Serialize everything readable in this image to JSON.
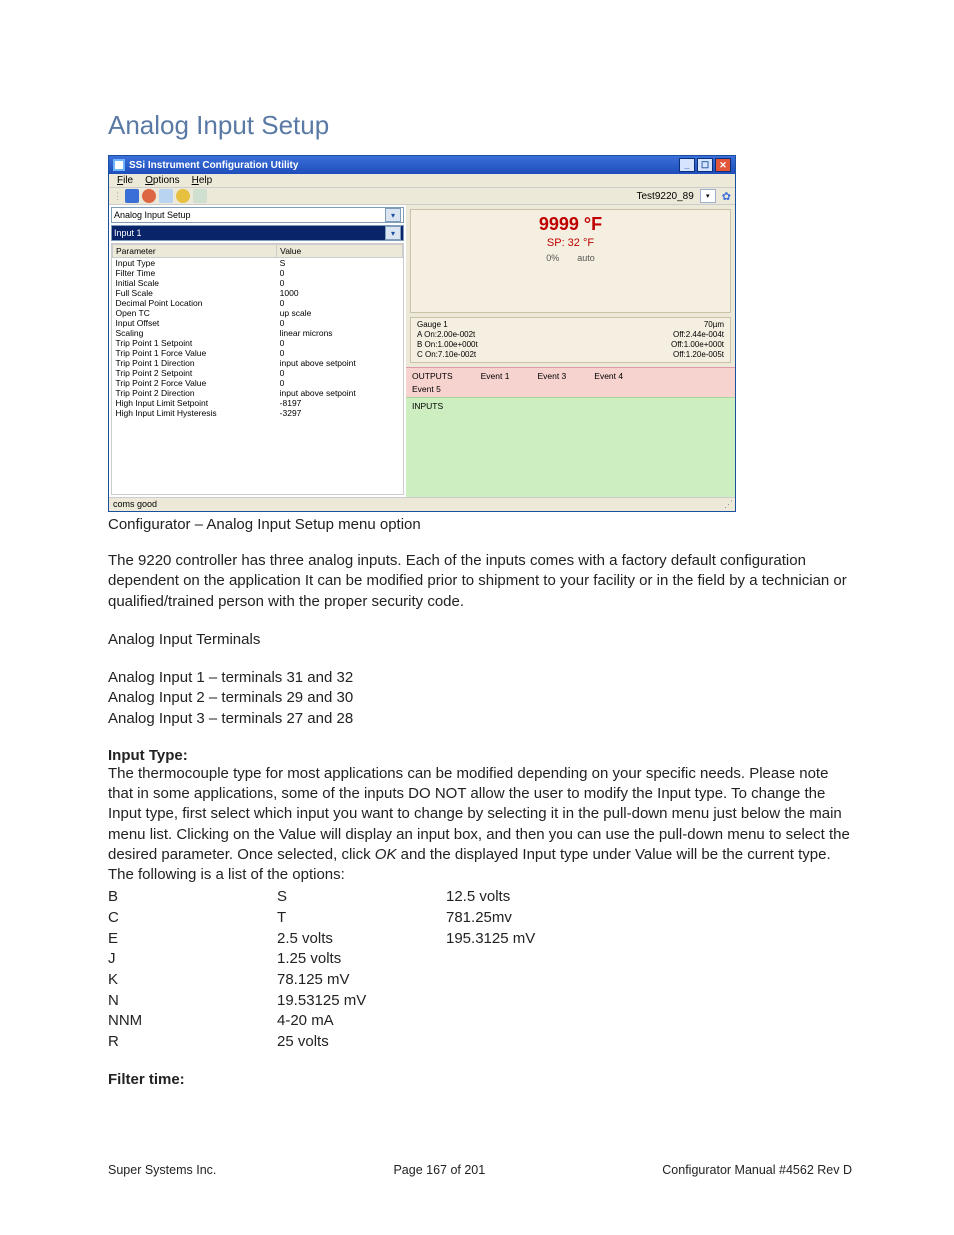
{
  "page_title": "Analog Input Setup",
  "screenshot": {
    "window_title": "SSi Instrument Configuration Utility",
    "menu": {
      "file": "File",
      "options": "Options",
      "help": "Help"
    },
    "toolbar_label": "Test9220_89",
    "dropdown_main": "Analog Input Setup",
    "dropdown_sub": "Input 1",
    "grid": {
      "col1": "Parameter",
      "col2": "Value",
      "rows": [
        {
          "p": "Input Type",
          "v": "S"
        },
        {
          "p": "Filter Time",
          "v": "0"
        },
        {
          "p": "Initial Scale",
          "v": "0"
        },
        {
          "p": "Full Scale",
          "v": "1000"
        },
        {
          "p": "Decimal Point Location",
          "v": "0"
        },
        {
          "p": "Open TC",
          "v": "up scale"
        },
        {
          "p": "Input Offset",
          "v": "0"
        },
        {
          "p": "Scaling",
          "v": "linear microns"
        },
        {
          "p": "Trip Point 1 Setpoint",
          "v": "0"
        },
        {
          "p": "Trip Point 1 Force Value",
          "v": "0"
        },
        {
          "p": "Trip Point 1 Direction",
          "v": "input above setpoint"
        },
        {
          "p": "Trip Point 2 Setpoint",
          "v": "0"
        },
        {
          "p": "Trip Point 2 Force Value",
          "v": "0"
        },
        {
          "p": "Trip Point 2 Direction",
          "v": "input above setpoint"
        },
        {
          "p": "High Input Limit Setpoint",
          "v": "-8197"
        },
        {
          "p": "High Input Limit Hysteresis",
          "v": "-3297"
        }
      ]
    },
    "readout": {
      "main": "9999 °F",
      "sp": "SP: 32 °F",
      "pct": "0%",
      "mode": "auto"
    },
    "gauge": {
      "title": "Gauge 1",
      "right": "70µm",
      "a_on": "A On:2.00e-002t",
      "a_off": "Off:2.44e-004t",
      "b_on": "B On:1.00e+000t",
      "b_off": "Off:1.00e+000t",
      "c_on": "C On:7.10e-002t",
      "c_off": "Off:1.20e-005t"
    },
    "outputs": {
      "label": "OUTPUTS",
      "e1": "Event 1",
      "e3": "Event 3",
      "e4": "Event 4",
      "e5": "Event 5"
    },
    "inputs_label": "INPUTS",
    "status": "coms good"
  },
  "caption": "Configurator – Analog Input Setup menu option",
  "body_para": "The 9220 controller has three analog inputs. Each of the inputs comes with a factory default configuration dependent on the application It can be modified prior to shipment to your facility or in the field by a technician or qualified/trained person with the proper security code.",
  "terminals": {
    "head": "Analog Input Terminals",
    "l1": "Analog Input 1 – terminals 31 and 32",
    "l2": "Analog Input 2 – terminals 29 and 30",
    "l3": "Analog Input 3 – terminals 27 and 28"
  },
  "input_type": {
    "head": "Input Type:",
    "para_a": "The thermocouple type for most applications can be modified depending on your specific needs. Please note that in some applications, some of the inputs DO NOT allow the user to modify the Input type. To change the Input type, first select which input you want to change by selecting it in the pull-down menu just below the main menu list. Clicking on the Value will display an input box, and then you can use the pull-down menu to select the desired parameter.  Once selected, click ",
    "ok": "OK",
    "para_b": " and the displayed Input type under Value will be the current type. The following is a list of the options:",
    "col1": [
      "B",
      "C",
      "E",
      "J",
      "K",
      "N",
      "NNM",
      "R"
    ],
    "col2": [
      "S",
      "T",
      "2.5 volts",
      "1.25 volts",
      "78.125 mV",
      "19.53125 mV",
      "4-20 mA",
      "25 volts"
    ],
    "col3": [
      "12.5 volts",
      "781.25mv",
      "195.3125 mV"
    ]
  },
  "filter_time_head": "Filter time:",
  "footer": {
    "left": "Super Systems Inc.",
    "center": "Page 167 of 201",
    "right": "Configurator Manual #4562 Rev D"
  }
}
